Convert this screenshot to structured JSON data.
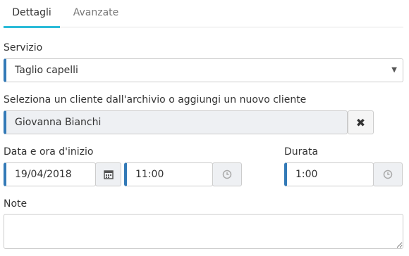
{
  "tabs": [
    {
      "label": "Dettagli",
      "active": true
    },
    {
      "label": "Avanzate",
      "active": false
    }
  ],
  "service": {
    "label": "Servizio",
    "value": "Taglio capelli"
  },
  "client": {
    "label": "Seleziona un cliente dall'archivio o aggiungi un nuovo cliente",
    "value": "Giovanna Bianchi"
  },
  "start": {
    "label": "Data e ora d'inizio",
    "date": "19/04/2018",
    "time": "11:00"
  },
  "duration": {
    "label": "Durata",
    "value": "1:00"
  },
  "note": {
    "label": "Note",
    "value": ""
  },
  "colors": {
    "accent": "#2bbbd8",
    "field_bar": "#337ab7"
  }
}
